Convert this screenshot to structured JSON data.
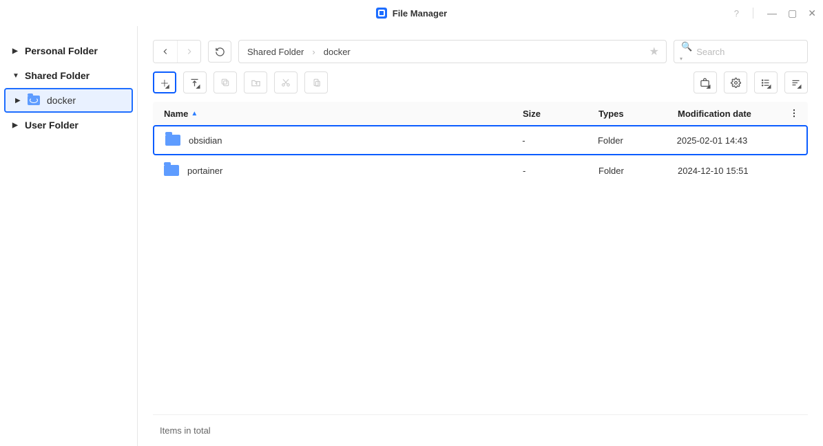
{
  "window": {
    "title": "File Manager"
  },
  "sidebar": {
    "items": [
      {
        "label": "Personal Folder",
        "expanded": false,
        "children": []
      },
      {
        "label": "Shared Folder",
        "expanded": true,
        "children": [
          {
            "label": "docker",
            "selected": true
          }
        ]
      },
      {
        "label": "User Folder",
        "expanded": false,
        "children": []
      }
    ]
  },
  "breadcrumb": {
    "items": [
      {
        "label": "Shared Folder"
      },
      {
        "label": "docker"
      }
    ]
  },
  "search": {
    "placeholder": "Search"
  },
  "table": {
    "columns": {
      "name": "Name",
      "size": "Size",
      "type": "Types",
      "date": "Modification date"
    },
    "rows": [
      {
        "name": "obsidian",
        "size": "-",
        "type": "Folder",
        "date": "2025-02-01 14:43",
        "selected": true
      },
      {
        "name": "portainer",
        "size": "-",
        "type": "Folder",
        "date": "2024-12-10 15:51",
        "selected": false
      }
    ]
  },
  "status": {
    "text": "Items in total"
  }
}
